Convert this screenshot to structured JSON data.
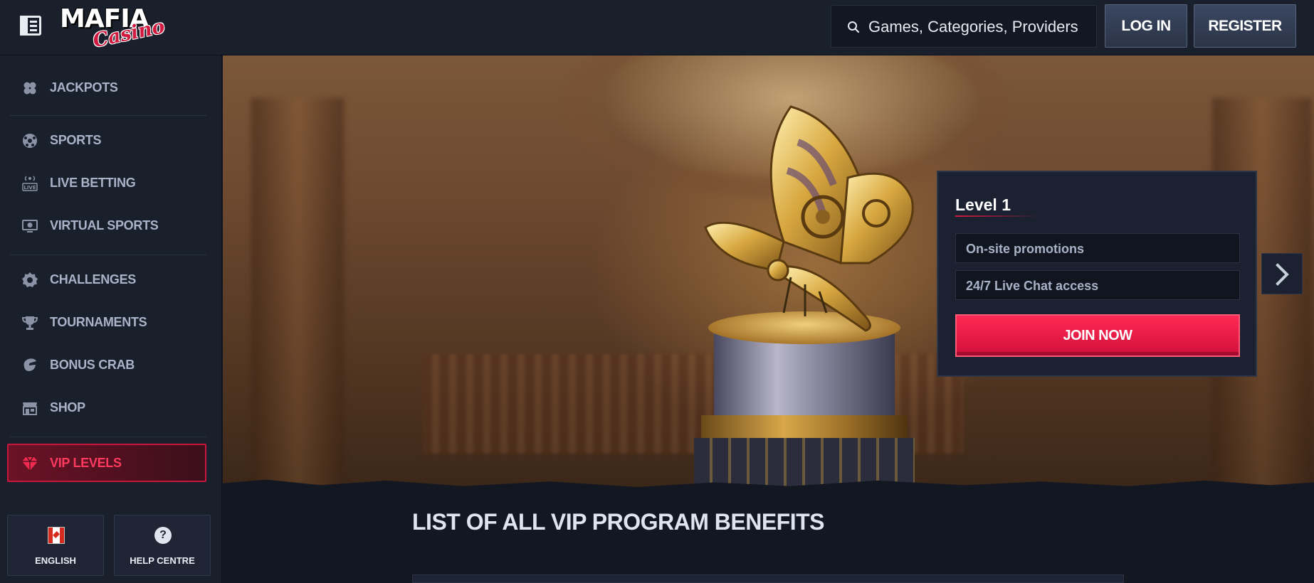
{
  "header": {
    "logo": {
      "top": "MAFIA",
      "script": "Casino"
    },
    "search_placeholder": "Games, Categories, Providers",
    "login_label": "LOG IN",
    "register_label": "REGISTER"
  },
  "sidebar": {
    "items": [
      {
        "label": "JACKPOTS",
        "icon": "clover-icon"
      },
      {
        "label": "SPORTS",
        "icon": "soccer-ball-icon"
      },
      {
        "label": "LIVE BETTING",
        "icon": "live-broadcast-icon"
      },
      {
        "label": "VIRTUAL SPORTS",
        "icon": "virtual-monitor-icon"
      },
      {
        "label": "CHALLENGES",
        "icon": "badge-icon"
      },
      {
        "label": "TOURNAMENTS",
        "icon": "trophy-icon"
      },
      {
        "label": "BONUS CRAB",
        "icon": "crab-claw-icon"
      },
      {
        "label": "SHOP",
        "icon": "shop-icon"
      },
      {
        "label": "VIP LEVELS",
        "icon": "diamond-icon",
        "active": true
      }
    ],
    "language_label": "ENGLISH",
    "help_label": "HELP CENTRE"
  },
  "hero": {
    "level_title": "Level 1",
    "benefits": [
      "On-site promotions",
      "24/7 Live Chat access"
    ],
    "cta_label": "JOIN NOW"
  },
  "section_title": "LIST OF ALL VIP PROGRAM BENEFITS",
  "colors": {
    "accent": "#e8163f",
    "background": "#131722",
    "panel": "#1a1f2c"
  }
}
